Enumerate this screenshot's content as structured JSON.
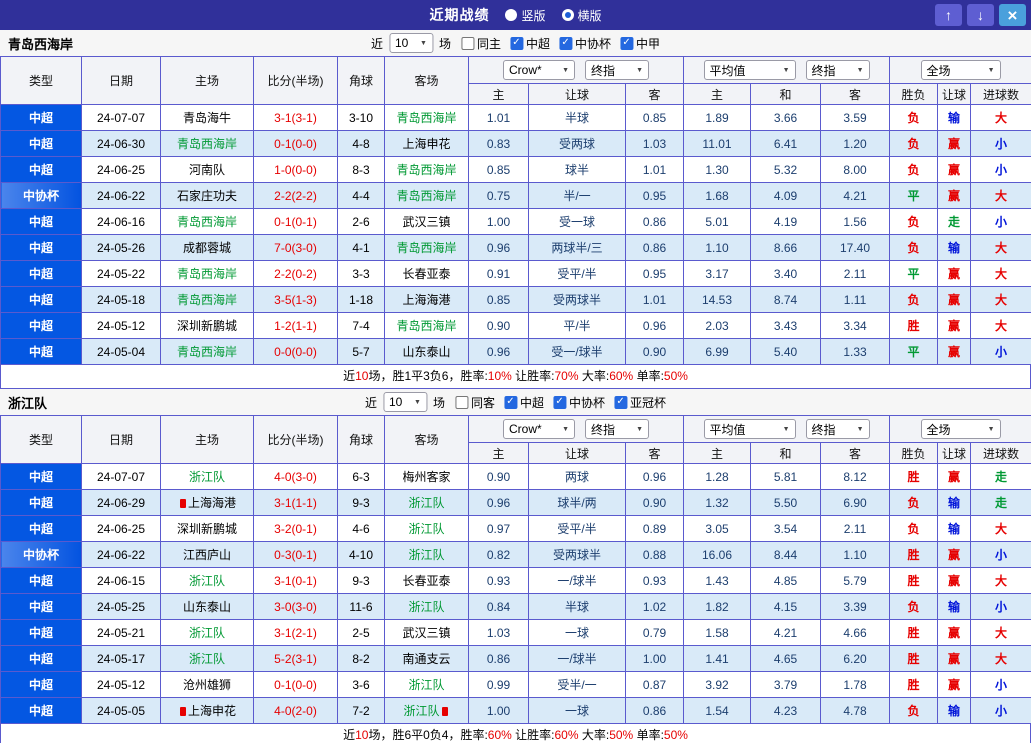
{
  "titlebar": {
    "title": "近期战绩",
    "radios": [
      {
        "label": "竖版",
        "selected": false
      },
      {
        "label": "横版",
        "selected": true
      }
    ],
    "buttons": {
      "up": "↑",
      "down": "↓",
      "close": "×"
    }
  },
  "icons": {
    "dropdown_arrow": "▼",
    "check": "✓"
  },
  "colors": {
    "header_bar": "#30309a",
    "league_blue": "#0457e2",
    "row_alt": "#d9eaf8",
    "highlight_green": "#009933",
    "score_red": "#e60000",
    "result_red": "#e60000",
    "result_blue": "#0014d9",
    "result_green": "#009933",
    "table_border": "#5a5ace"
  },
  "table": {
    "col_headers": [
      "类型",
      "日期",
      "主场",
      "比分(半场)",
      "角球",
      "客场"
    ],
    "sub_headers": [
      "主",
      "让球",
      "客",
      "主",
      "和",
      "客",
      "胜负",
      "让球",
      "进球数"
    ]
  },
  "sections": [
    {
      "team": "青岛西海岸",
      "filter": {
        "near_label": "近",
        "count": "10",
        "games_label": "场",
        "checkboxes": [
          {
            "label": "同主",
            "checked": false
          },
          {
            "label": "中超",
            "checked": true
          },
          {
            "label": "中协杯",
            "checked": true
          },
          {
            "label": "中甲",
            "checked": true
          }
        ]
      },
      "controls": {
        "provider": "Crow*",
        "final1": "终指",
        "average": "平均值",
        "final2": "终指",
        "scope": "全场"
      },
      "rows": [
        {
          "type": "中超",
          "cup": false,
          "date": "24-07-07",
          "home": "青岛海牛",
          "home_hl": false,
          "home_mark": false,
          "score": "3-1(3-1)",
          "corner": "3-10",
          "away": "青岛西海岸",
          "away_hl": true,
          "away_mark": false,
          "o1": "1.01",
          "handicap": "半球",
          "o2": "0.85",
          "avg_h": "1.89",
          "avg_d": "3.66",
          "avg_a": "3.59",
          "r1": "负",
          "r1c": "red",
          "r2": "输",
          "r2c": "blue",
          "r3": "大",
          "r3c": "red"
        },
        {
          "type": "中超",
          "cup": false,
          "date": "24-06-30",
          "home": "青岛西海岸",
          "home_hl": true,
          "home_mark": false,
          "score": "0-1(0-0)",
          "corner": "4-8",
          "away": "上海申花",
          "away_hl": false,
          "away_mark": false,
          "o1": "0.83",
          "handicap": "受两球",
          "o2": "1.03",
          "avg_h": "11.01",
          "avg_d": "6.41",
          "avg_a": "1.20",
          "r1": "负",
          "r1c": "red",
          "r2": "赢",
          "r2c": "red",
          "r3": "小",
          "r3c": "blue"
        },
        {
          "type": "中超",
          "cup": false,
          "date": "24-06-25",
          "home": "河南队",
          "home_hl": false,
          "home_mark": false,
          "score": "1-0(0-0)",
          "corner": "8-3",
          "away": "青岛西海岸",
          "away_hl": true,
          "away_mark": false,
          "o1": "0.85",
          "handicap": "球半",
          "o2": "1.01",
          "avg_h": "1.30",
          "avg_d": "5.32",
          "avg_a": "8.00",
          "r1": "负",
          "r1c": "red",
          "r2": "赢",
          "r2c": "red",
          "r3": "小",
          "r3c": "blue"
        },
        {
          "type": "中协杯",
          "cup": true,
          "date": "24-06-22",
          "home": "石家庄功夫",
          "home_hl": false,
          "home_mark": false,
          "score": "2-2(2-2)",
          "corner": "4-4",
          "away": "青岛西海岸",
          "away_hl": true,
          "away_mark": false,
          "o1": "0.75",
          "handicap": "半/一",
          "o2": "0.95",
          "avg_h": "1.68",
          "avg_d": "4.09",
          "avg_a": "4.21",
          "r1": "平",
          "r1c": "green",
          "r2": "赢",
          "r2c": "red",
          "r3": "大",
          "r3c": "red"
        },
        {
          "type": "中超",
          "cup": false,
          "date": "24-06-16",
          "home": "青岛西海岸",
          "home_hl": true,
          "home_mark": false,
          "score": "0-1(0-1)",
          "corner": "2-6",
          "away": "武汉三镇",
          "away_hl": false,
          "away_mark": false,
          "o1": "1.00",
          "handicap": "受一球",
          "o2": "0.86",
          "avg_h": "5.01",
          "avg_d": "4.19",
          "avg_a": "1.56",
          "r1": "负",
          "r1c": "red",
          "r2": "走",
          "r2c": "green",
          "r3": "小",
          "r3c": "blue"
        },
        {
          "type": "中超",
          "cup": false,
          "date": "24-05-26",
          "home": "成都蓉城",
          "home_hl": false,
          "home_mark": false,
          "score": "7-0(3-0)",
          "corner": "4-1",
          "away": "青岛西海岸",
          "away_hl": true,
          "away_mark": false,
          "o1": "0.96",
          "handicap": "两球半/三",
          "o2": "0.86",
          "avg_h": "1.10",
          "avg_d": "8.66",
          "avg_a": "17.40",
          "r1": "负",
          "r1c": "red",
          "r2": "输",
          "r2c": "blue",
          "r3": "大",
          "r3c": "red"
        },
        {
          "type": "中超",
          "cup": false,
          "date": "24-05-22",
          "home": "青岛西海岸",
          "home_hl": true,
          "home_mark": false,
          "score": "2-2(0-2)",
          "corner": "3-3",
          "away": "长春亚泰",
          "away_hl": false,
          "away_mark": false,
          "o1": "0.91",
          "handicap": "受平/半",
          "o2": "0.95",
          "avg_h": "3.17",
          "avg_d": "3.40",
          "avg_a": "2.11",
          "r1": "平",
          "r1c": "green",
          "r2": "赢",
          "r2c": "red",
          "r3": "大",
          "r3c": "red"
        },
        {
          "type": "中超",
          "cup": false,
          "date": "24-05-18",
          "home": "青岛西海岸",
          "home_hl": true,
          "home_mark": false,
          "score": "3-5(1-3)",
          "corner": "1-18",
          "away": "上海海港",
          "away_hl": false,
          "away_mark": false,
          "o1": "0.85",
          "handicap": "受两球半",
          "o2": "1.01",
          "avg_h": "14.53",
          "avg_d": "8.74",
          "avg_a": "1.11",
          "r1": "负",
          "r1c": "red",
          "r2": "赢",
          "r2c": "red",
          "r3": "大",
          "r3c": "red"
        },
        {
          "type": "中超",
          "cup": false,
          "date": "24-05-12",
          "home": "深圳新鹏城",
          "home_hl": false,
          "home_mark": false,
          "score": "1-2(1-1)",
          "corner": "7-4",
          "away": "青岛西海岸",
          "away_hl": true,
          "away_mark": false,
          "o1": "0.90",
          "handicap": "平/半",
          "o2": "0.96",
          "avg_h": "2.03",
          "avg_d": "3.43",
          "avg_a": "3.34",
          "r1": "胜",
          "r1c": "red",
          "r2": "赢",
          "r2c": "red",
          "r3": "大",
          "r3c": "red"
        },
        {
          "type": "中超",
          "cup": false,
          "date": "24-05-04",
          "home": "青岛西海岸",
          "home_hl": true,
          "home_mark": false,
          "score": "0-0(0-0)",
          "corner": "5-7",
          "away": "山东泰山",
          "away_hl": false,
          "away_mark": false,
          "o1": "0.96",
          "handicap": "受一/球半",
          "o2": "0.90",
          "avg_h": "6.99",
          "avg_d": "5.40",
          "avg_a": "1.33",
          "r1": "平",
          "r1c": "green",
          "r2": "赢",
          "r2c": "red",
          "r3": "小",
          "r3c": "blue"
        }
      ],
      "footer": [
        {
          "t": "近",
          "red": false
        },
        {
          "t": "10",
          "red": true
        },
        {
          "t": "场，胜1平3负6，胜率:",
          "red": false
        },
        {
          "t": "10%",
          "red": true
        },
        {
          "t": " 让胜率:",
          "red": false
        },
        {
          "t": "70%",
          "red": true
        },
        {
          "t": " 大率:",
          "red": false
        },
        {
          "t": "60%",
          "red": true
        },
        {
          "t": " 单率:",
          "red": false
        },
        {
          "t": "50%",
          "red": true
        }
      ]
    },
    {
      "team": "浙江队",
      "filter": {
        "near_label": "近",
        "count": "10",
        "games_label": "场",
        "checkboxes": [
          {
            "label": "同客",
            "checked": false
          },
          {
            "label": "中超",
            "checked": true
          },
          {
            "label": "中协杯",
            "checked": true
          },
          {
            "label": "亚冠杯",
            "checked": true
          }
        ]
      },
      "controls": {
        "provider": "Crow*",
        "final1": "终指",
        "average": "平均值",
        "final2": "终指",
        "scope": "全场"
      },
      "rows": [
        {
          "type": "中超",
          "cup": false,
          "date": "24-07-07",
          "home": "浙江队",
          "home_hl": true,
          "home_mark": false,
          "score": "4-0(3-0)",
          "corner": "6-3",
          "away": "梅州客家",
          "away_hl": false,
          "away_mark": false,
          "o1": "0.90",
          "handicap": "两球",
          "o2": "0.96",
          "avg_h": "1.28",
          "avg_d": "5.81",
          "avg_a": "8.12",
          "r1": "胜",
          "r1c": "red",
          "r2": "赢",
          "r2c": "red",
          "r3": "走",
          "r3c": "green"
        },
        {
          "type": "中超",
          "cup": false,
          "date": "24-06-29",
          "home": "上海海港",
          "home_hl": false,
          "home_mark": true,
          "score": "3-1(1-1)",
          "corner": "9-3",
          "away": "浙江队",
          "away_hl": true,
          "away_mark": false,
          "o1": "0.96",
          "handicap": "球半/两",
          "o2": "0.90",
          "avg_h": "1.32",
          "avg_d": "5.50",
          "avg_a": "6.90",
          "r1": "负",
          "r1c": "red",
          "r2": "输",
          "r2c": "blue",
          "r3": "走",
          "r3c": "green"
        },
        {
          "type": "中超",
          "cup": false,
          "date": "24-06-25",
          "home": "深圳新鹏城",
          "home_hl": false,
          "home_mark": false,
          "score": "3-2(0-1)",
          "corner": "4-6",
          "away": "浙江队",
          "away_hl": true,
          "away_mark": false,
          "o1": "0.97",
          "handicap": "受平/半",
          "o2": "0.89",
          "avg_h": "3.05",
          "avg_d": "3.54",
          "avg_a": "2.11",
          "r1": "负",
          "r1c": "red",
          "r2": "输",
          "r2c": "blue",
          "r3": "大",
          "r3c": "red"
        },
        {
          "type": "中协杯",
          "cup": true,
          "date": "24-06-22",
          "home": "江西庐山",
          "home_hl": false,
          "home_mark": false,
          "score": "0-3(0-1)",
          "corner": "4-10",
          "away": "浙江队",
          "away_hl": true,
          "away_mark": false,
          "o1": "0.82",
          "handicap": "受两球半",
          "o2": "0.88",
          "avg_h": "16.06",
          "avg_d": "8.44",
          "avg_a": "1.10",
          "r1": "胜",
          "r1c": "red",
          "r2": "赢",
          "r2c": "red",
          "r3": "小",
          "r3c": "blue"
        },
        {
          "type": "中超",
          "cup": false,
          "date": "24-06-15",
          "home": "浙江队",
          "home_hl": true,
          "home_mark": false,
          "score": "3-1(0-1)",
          "corner": "9-3",
          "away": "长春亚泰",
          "away_hl": false,
          "away_mark": false,
          "o1": "0.93",
          "handicap": "一/球半",
          "o2": "0.93",
          "avg_h": "1.43",
          "avg_d": "4.85",
          "avg_a": "5.79",
          "r1": "胜",
          "r1c": "red",
          "r2": "赢",
          "r2c": "red",
          "r3": "大",
          "r3c": "red"
        },
        {
          "type": "中超",
          "cup": false,
          "date": "24-05-25",
          "home": "山东泰山",
          "home_hl": false,
          "home_mark": false,
          "score": "3-0(3-0)",
          "corner": "11-6",
          "away": "浙江队",
          "away_hl": true,
          "away_mark": false,
          "o1": "0.84",
          "handicap": "半球",
          "o2": "1.02",
          "avg_h": "1.82",
          "avg_d": "4.15",
          "avg_a": "3.39",
          "r1": "负",
          "r1c": "red",
          "r2": "输",
          "r2c": "blue",
          "r3": "小",
          "r3c": "blue"
        },
        {
          "type": "中超",
          "cup": false,
          "date": "24-05-21",
          "home": "浙江队",
          "home_hl": true,
          "home_mark": false,
          "score": "3-1(2-1)",
          "corner": "2-5",
          "away": "武汉三镇",
          "away_hl": false,
          "away_mark": false,
          "o1": "1.03",
          "handicap": "一球",
          "o2": "0.79",
          "avg_h": "1.58",
          "avg_d": "4.21",
          "avg_a": "4.66",
          "r1": "胜",
          "r1c": "red",
          "r2": "赢",
          "r2c": "red",
          "r3": "大",
          "r3c": "red"
        },
        {
          "type": "中超",
          "cup": false,
          "date": "24-05-17",
          "home": "浙江队",
          "home_hl": true,
          "home_mark": false,
          "score": "5-2(3-1)",
          "corner": "8-2",
          "away": "南通支云",
          "away_hl": false,
          "away_mark": false,
          "o1": "0.86",
          "handicap": "一/球半",
          "o2": "1.00",
          "avg_h": "1.41",
          "avg_d": "4.65",
          "avg_a": "6.20",
          "r1": "胜",
          "r1c": "red",
          "r2": "赢",
          "r2c": "red",
          "r3": "大",
          "r3c": "red"
        },
        {
          "type": "中超",
          "cup": false,
          "date": "24-05-12",
          "home": "沧州雄狮",
          "home_hl": false,
          "home_mark": false,
          "score": "0-1(0-0)",
          "corner": "3-6",
          "away": "浙江队",
          "away_hl": true,
          "away_mark": false,
          "o1": "0.99",
          "handicap": "受半/一",
          "o2": "0.87",
          "avg_h": "3.92",
          "avg_d": "3.79",
          "avg_a": "1.78",
          "r1": "胜",
          "r1c": "red",
          "r2": "赢",
          "r2c": "red",
          "r3": "小",
          "r3c": "blue"
        },
        {
          "type": "中超",
          "cup": false,
          "date": "24-05-05",
          "home": "上海申花",
          "home_hl": false,
          "home_mark": true,
          "score": "4-0(2-0)",
          "corner": "7-2",
          "away": "浙江队",
          "away_hl": true,
          "away_mark": true,
          "o1": "1.00",
          "handicap": "一球",
          "o2": "0.86",
          "avg_h": "1.54",
          "avg_d": "4.23",
          "avg_a": "4.78",
          "r1": "负",
          "r1c": "red",
          "r2": "输",
          "r2c": "blue",
          "r3": "小",
          "r3c": "blue"
        }
      ],
      "footer": [
        {
          "t": "近",
          "red": false
        },
        {
          "t": "10",
          "red": true
        },
        {
          "t": "场，胜6平0负4，胜率:",
          "red": false
        },
        {
          "t": "60%",
          "red": true
        },
        {
          "t": " 让胜率:",
          "red": false
        },
        {
          "t": "60%",
          "red": true
        },
        {
          "t": " 大率:",
          "red": false
        },
        {
          "t": "50%",
          "red": true
        },
        {
          "t": " 单率:",
          "red": false
        },
        {
          "t": "50%",
          "red": true
        }
      ]
    }
  ]
}
